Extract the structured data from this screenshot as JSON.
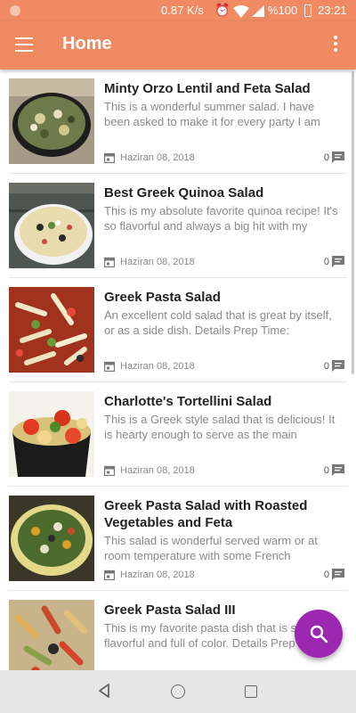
{
  "status_bar": {
    "speed": "0.87 K/s",
    "battery": "%100",
    "time": "23:21"
  },
  "app_bar": {
    "title": "Home"
  },
  "articles": [
    {
      "title": "Minty Orzo Lentil and Feta Salad",
      "description": "This is a wonderful summer salad. I have been asked to make it for every party I am",
      "date": "Haziran 08, 2018",
      "comments": "0"
    },
    {
      "title": "Best Greek Quinoa Salad",
      "description": "This is my absolute favorite quinoa recipe! It's so flavorful and always a big hit with my",
      "date": "Haziran 08, 2018",
      "comments": "0"
    },
    {
      "title": "Greek Pasta Salad",
      "description": "An excellent cold salad that is great by itself, or as a side dish. Details Prep Time:",
      "date": "Haziran 08, 2018",
      "comments": "0"
    },
    {
      "title": "Charlotte's Tortellini Salad",
      "description": "This is a Greek style salad that is delicious! It is hearty enough to serve as the main",
      "date": "Haziran 08, 2018",
      "comments": "0"
    },
    {
      "title": "Greek Pasta Salad with Roasted Vegetables and Feta",
      "description": "This salad is wonderful served warm or at room temperature with some French",
      "date": "Haziran 08, 2018",
      "comments": "0"
    },
    {
      "title": "Greek Pasta Salad III",
      "description": "This is my favorite pasta dish that is so flavorful and full of color. Details Prep",
      "date": "",
      "comments": ""
    }
  ],
  "colors": {
    "accent": "#ef8a63",
    "fab": "#9c27b0"
  },
  "icons": {
    "menu": "hamburger-menu-icon",
    "more": "more-vert-icon",
    "date": "calendar-icon",
    "comments": "comment-icon",
    "fab": "search-icon"
  }
}
